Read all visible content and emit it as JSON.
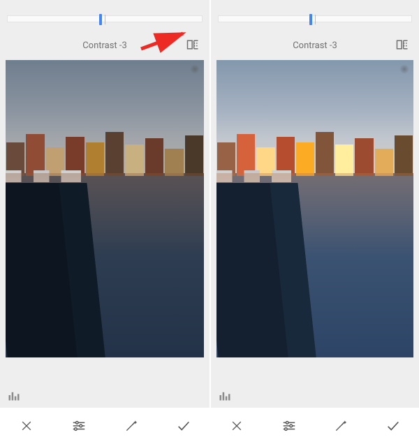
{
  "panes": [
    {
      "adjust_label": "Contrast -3",
      "slider_percent": 48,
      "compare_icon": "compare-icon",
      "show_arrow": true,
      "bright": false
    },
    {
      "adjust_label": "Contrast -3",
      "slider_percent": 48,
      "compare_icon": "compare-icon",
      "show_arrow": false,
      "bright": true
    }
  ],
  "toolbar": {
    "cancel": "✕",
    "tune": "tune",
    "magic": "magic",
    "confirm": "✓"
  },
  "colors": {
    "accent": "#4285f4",
    "arrow": "#ee2a24"
  }
}
